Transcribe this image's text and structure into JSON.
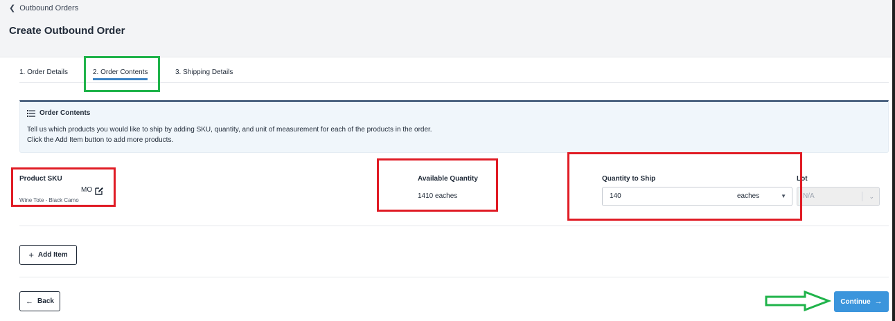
{
  "breadcrumb": {
    "label": "Outbound Orders"
  },
  "page": {
    "title": "Create Outbound Order"
  },
  "tabs": [
    {
      "label": "1. Order Details"
    },
    {
      "label": "2. Order Contents"
    },
    {
      "label": "3. Shipping Details"
    }
  ],
  "info": {
    "title": "Order Contents",
    "line1": "Tell us which products you would like to ship by adding SKU, quantity, and unit of measurement for each of the products in the order.",
    "line2": "Click the Add Item button to add more products."
  },
  "columns": {
    "sku": "Product SKU",
    "available": "Available Quantity",
    "qty": "Quantity to Ship",
    "lot": "Lot"
  },
  "item": {
    "sku_visible": "MO",
    "description": "Wine Tote - Black Camo",
    "available": "1410 eaches",
    "qty": "140",
    "uom": "eaches",
    "lot": "N/A"
  },
  "buttons": {
    "add_item": "Add Item",
    "back": "Back",
    "continue": "Continue"
  },
  "colors": {
    "accent": "#3b95dc",
    "highlight_red": "#e01b24",
    "highlight_green": "#1fb34a"
  }
}
